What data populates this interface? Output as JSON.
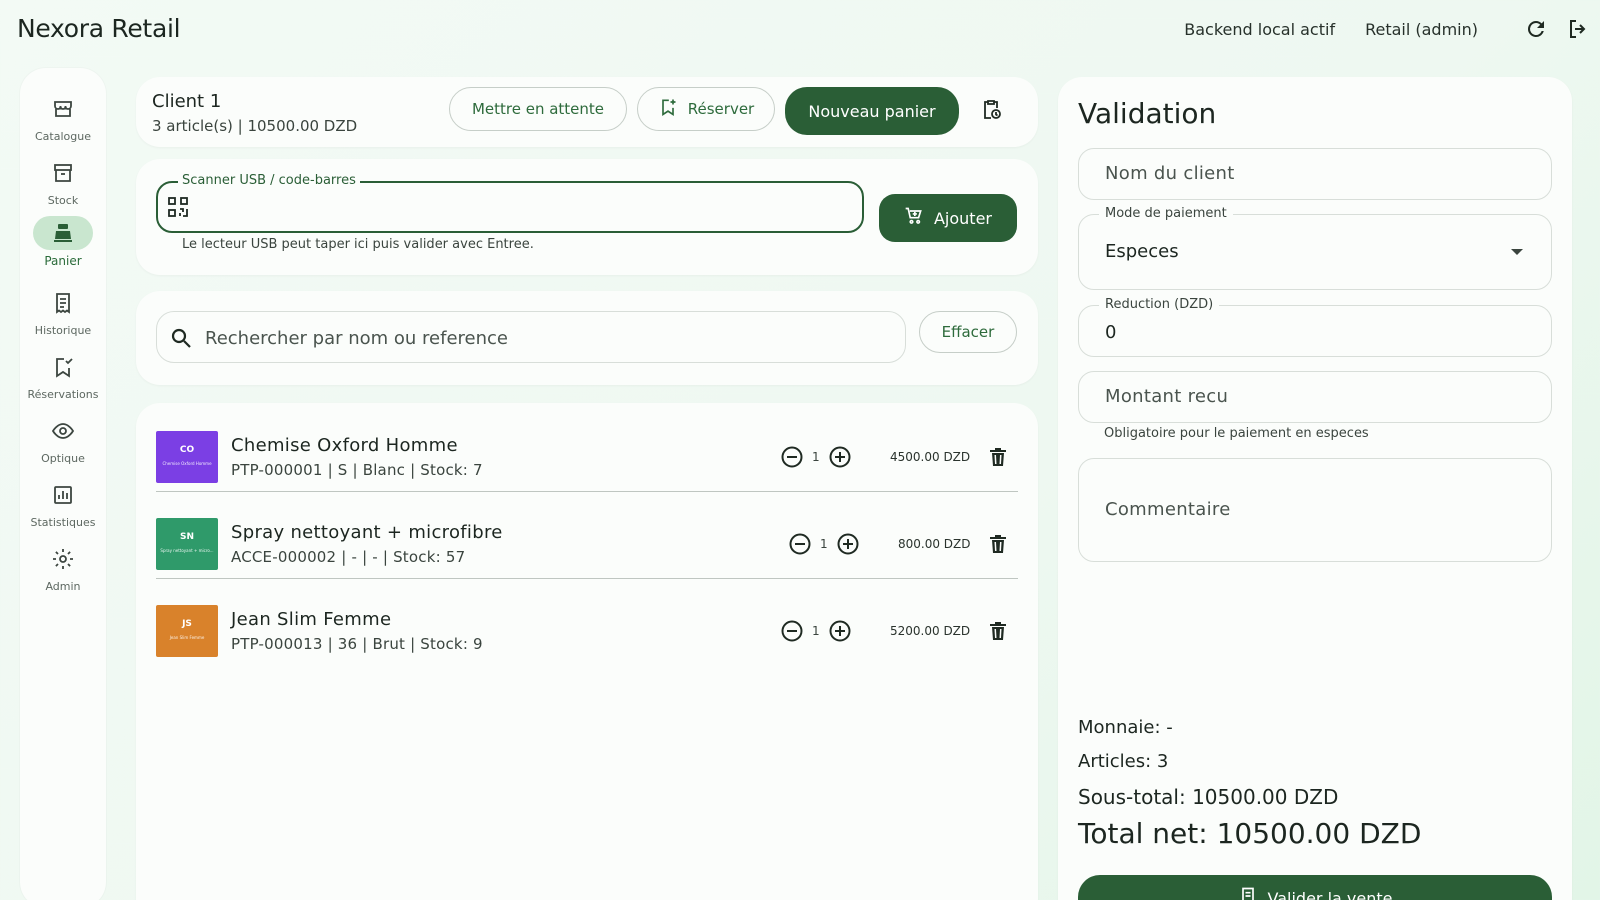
{
  "app": {
    "title": "Nexora Retail"
  },
  "topbar": {
    "backend_status": "Backend local actif",
    "role": "Retail (admin)",
    "refresh_icon": "refresh-icon",
    "logout_icon": "logout-icon"
  },
  "sidebar": {
    "items": [
      {
        "label": "Catalogue",
        "icon": "store-icon",
        "active": false
      },
      {
        "label": "Stock",
        "icon": "archive-icon",
        "active": false
      },
      {
        "label": "Panier",
        "icon": "cash-register-icon",
        "active": true
      },
      {
        "label": "Historique",
        "icon": "receipt-icon",
        "active": false
      },
      {
        "label": "Réservations",
        "icon": "bookmark-check-icon",
        "active": false
      },
      {
        "label": "Optique",
        "icon": "eye-icon",
        "active": false
      },
      {
        "label": "Statistiques",
        "icon": "chart-icon",
        "active": false
      },
      {
        "label": "Admin",
        "icon": "gear-icon",
        "active": false
      }
    ]
  },
  "cart": {
    "client": "Client 1",
    "summary": "3 article(s) | 10500.00 DZD",
    "hold_label": "Mettre en attente",
    "reserve_label": "Réserver",
    "new_cart_label": "Nouveau panier"
  },
  "scanner": {
    "label": "Scanner USB / code-barres",
    "value": "",
    "hint": "Le lecteur USB peut taper ici puis valider avec Entree.",
    "add_label": "Ajouter"
  },
  "search": {
    "placeholder": "Rechercher par nom ou reference",
    "clear_label": "Effacer"
  },
  "items": [
    {
      "initials": "CO",
      "thumb_caption": "Chemise Oxford Homme",
      "name": "Chemise Oxford Homme",
      "meta": "PTP-000001 | S | Blanc | Stock: 7",
      "qty": "1",
      "price": "4500.00 DZD",
      "color": "#7b3fe4"
    },
    {
      "initials": "SN",
      "thumb_caption": "Spray nettoyant + micro...",
      "name": "Spray nettoyant + microfibre",
      "meta": "ACCE-000002 | - | - | Stock: 57",
      "qty": "1",
      "price": "800.00 DZD",
      "color": "#2f9a6a"
    },
    {
      "initials": "JS",
      "thumb_caption": "Jean Slim Femme",
      "name": "Jean Slim Femme",
      "meta": "PTP-000013 | 36 | Brut | Stock: 9",
      "qty": "1",
      "price": "5200.00 DZD",
      "color": "#d9822b"
    }
  ],
  "validation": {
    "title": "Validation",
    "client_name_placeholder": "Nom du client",
    "payment_label": "Mode de paiement",
    "payment_value": "Especes",
    "discount_label": "Reduction (DZD)",
    "discount_value": "0",
    "received_placeholder": "Montant recu",
    "received_hint": "Obligatoire pour le paiement en especes",
    "comment_placeholder": "Commentaire",
    "change": "Monnaie: -",
    "articles": "Articles: 3",
    "subtotal": "Sous-total: 10500.00 DZD",
    "total": "Total net: 10500.00 DZD",
    "validate_label": "Valider la vente"
  },
  "colors": {
    "primary": "#2a5e36",
    "accent_light": "#c9e6cf",
    "background": "#eef8f1"
  }
}
